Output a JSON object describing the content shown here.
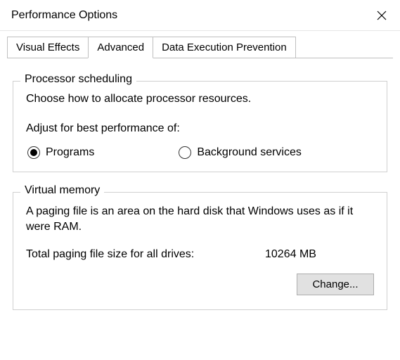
{
  "title": "Performance Options",
  "tabs": {
    "visual_effects": "Visual Effects",
    "advanced": "Advanced",
    "dep": "Data Execution Prevention"
  },
  "processor": {
    "legend": "Processor scheduling",
    "desc": "Choose how to allocate processor resources.",
    "adjust_label": "Adjust for best performance of:",
    "programs_label": "Programs",
    "background_label": "Background services",
    "selected": "programs"
  },
  "vm": {
    "legend": "Virtual memory",
    "desc": "A paging file is an area on the hard disk that Windows uses as if it were RAM.",
    "total_label": "Total paging file size for all drives:",
    "total_value": "10264 MB",
    "change_button": "Change..."
  }
}
